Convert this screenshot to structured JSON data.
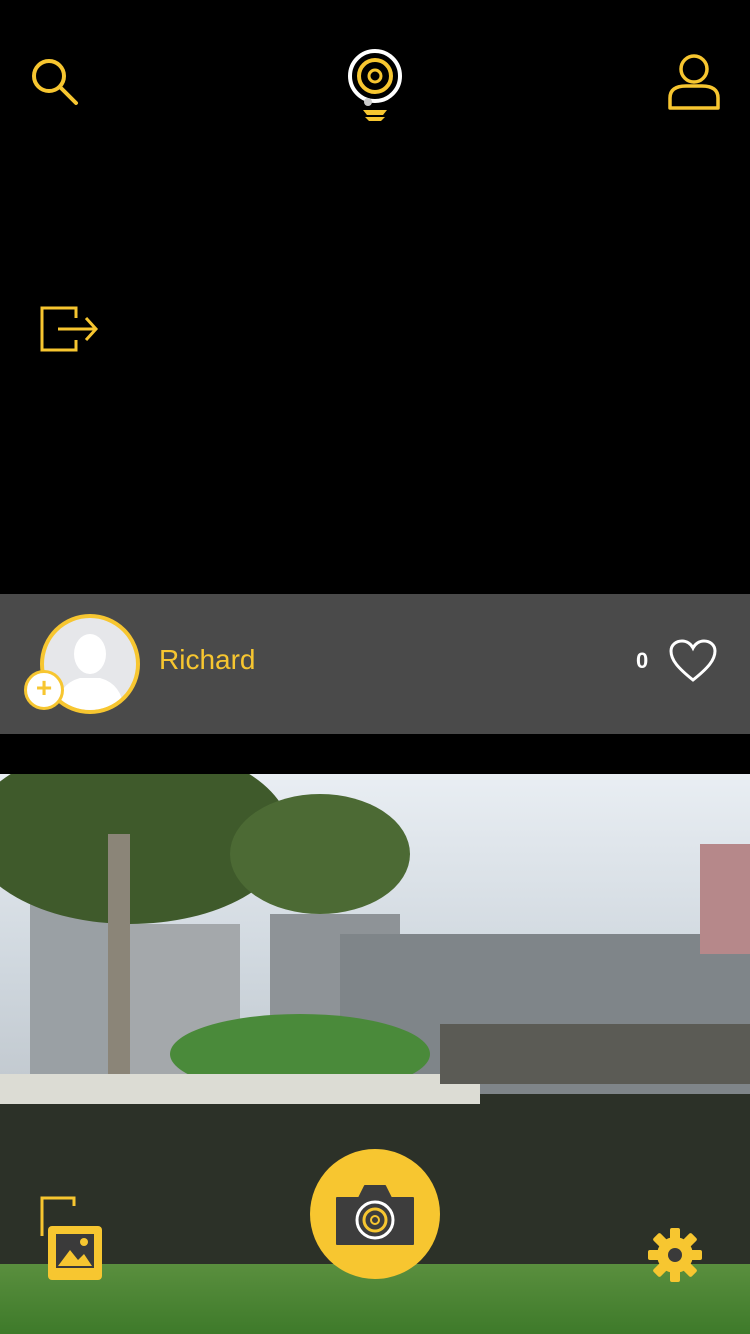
{
  "header": {
    "search_icon": "search-icon",
    "logo_icon": "app-logo-icon",
    "profile_icon": "user-profile-icon"
  },
  "logout_icon": "logout-icon",
  "user_card": {
    "name": "Richard",
    "likes": "0",
    "add_icon": "plus-icon",
    "heart_icon": "heart-icon"
  },
  "bottom_bar": {
    "gallery_icon": "gallery-icon",
    "camera_icon": "camera-icon",
    "settings_icon": "gear-icon"
  },
  "colors": {
    "accent": "#f7c630",
    "background": "#000000",
    "card": "#4a4a4a"
  }
}
